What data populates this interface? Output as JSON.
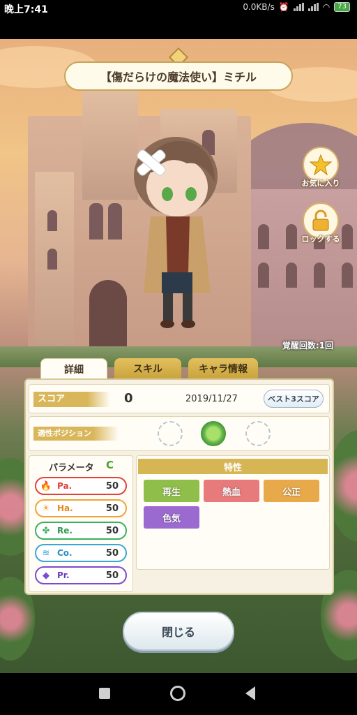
{
  "status_bar": {
    "time": "晚上7:41",
    "network_speed": "0.0KB/s",
    "battery": "73"
  },
  "header": {
    "title": "【傷だらけの魔法使い】ミチル"
  },
  "side_buttons": {
    "favorite_label": "お気に入り",
    "lock_label": "ロックする"
  },
  "character": {
    "awaken_count": "覚醒回数:1回"
  },
  "tabs": [
    {
      "label": "詳細",
      "active": true
    },
    {
      "label": "スキル",
      "active": false
    },
    {
      "label": "キャラ情報",
      "active": false
    }
  ],
  "score": {
    "label": "スコア",
    "value": "0",
    "date": "2019/11/27",
    "best3_button": "ベスト3スコア"
  },
  "position": {
    "label": "適性ポジション"
  },
  "parameters": {
    "title": "パラメータ",
    "rank": "C",
    "items": [
      {
        "name": "Pa.",
        "value": "50",
        "color": "#e0433a",
        "icon": "fire-icon"
      },
      {
        "name": "Ha.",
        "value": "50",
        "color": "#f0a23a",
        "icon": "sun-icon"
      },
      {
        "name": "Re.",
        "value": "50",
        "color": "#3bb060",
        "icon": "clover-icon"
      },
      {
        "name": "Co.",
        "value": "50",
        "color": "#3aa6d8",
        "icon": "wave-icon"
      },
      {
        "name": "Pr.",
        "value": "50",
        "color": "#7a4ad0",
        "icon": "diamond-icon"
      }
    ]
  },
  "traits": {
    "title": "特性",
    "items": [
      {
        "label": "再生",
        "color": "#8fbf4a"
      },
      {
        "label": "熱血",
        "color": "#e77a7a"
      },
      {
        "label": "公正",
        "color": "#e8a94a"
      },
      {
        "label": "色気",
        "color": "#9b6ad0"
      }
    ]
  },
  "close_button": "閉じる"
}
